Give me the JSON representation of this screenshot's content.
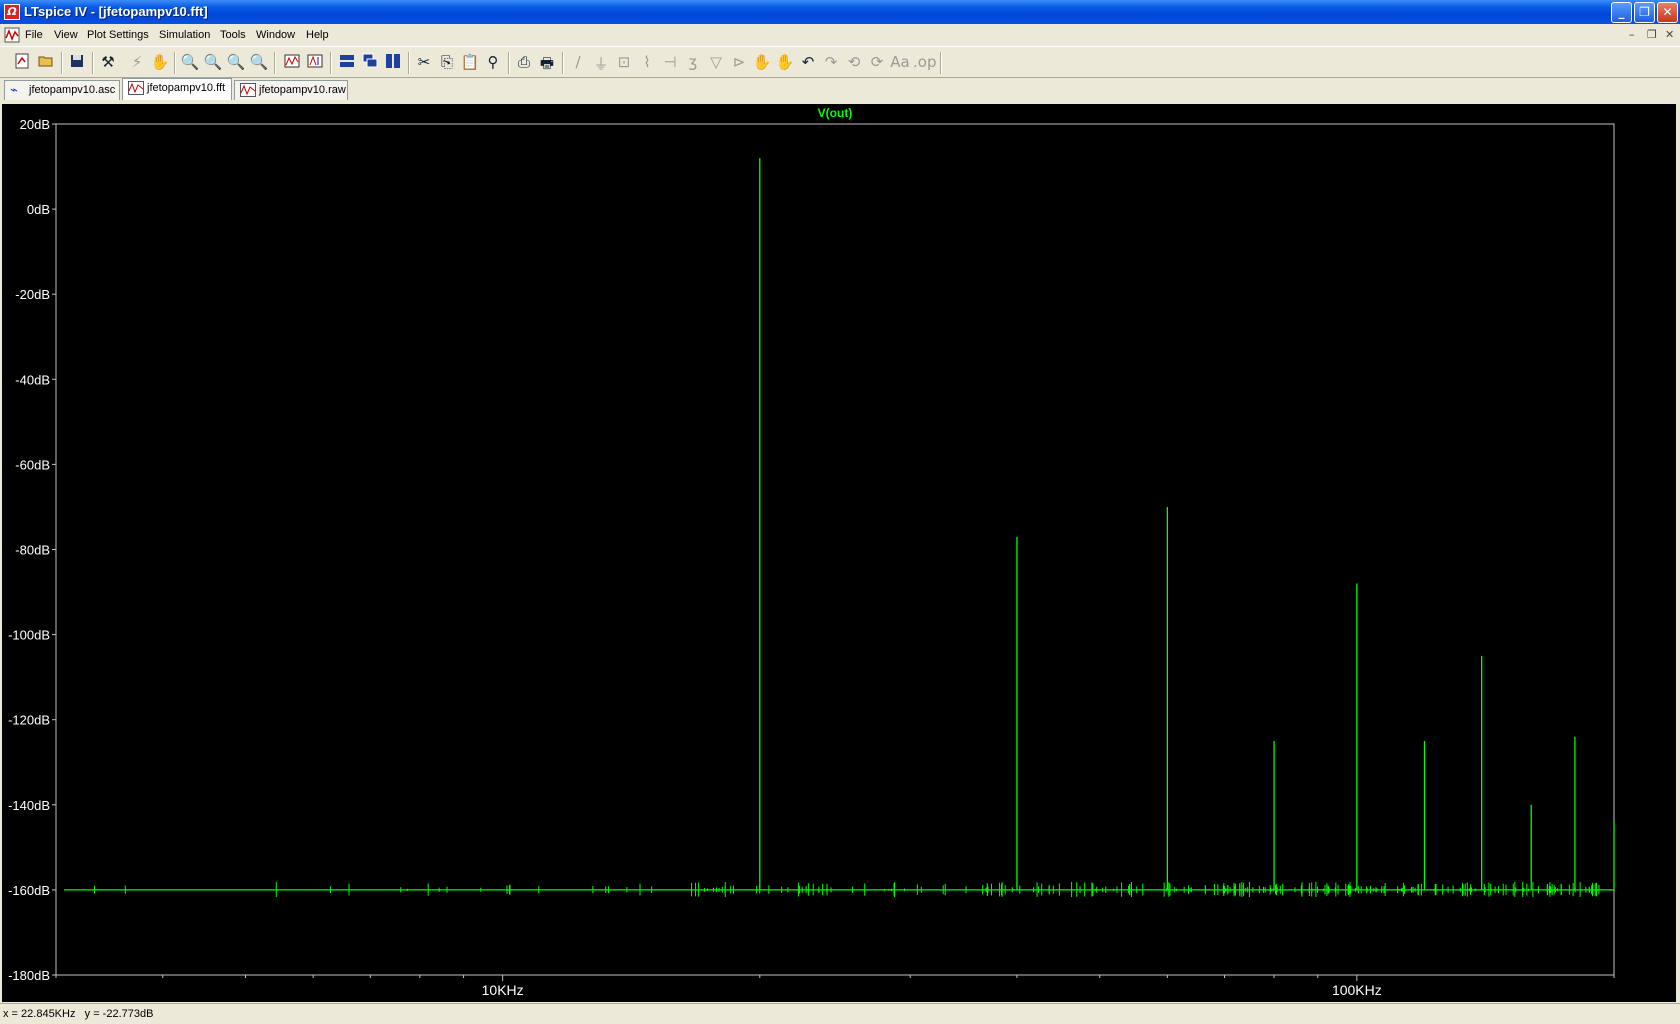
{
  "window": {
    "title": "LTspice IV - [jfetopampv10.fft]",
    "buttons": {
      "minimize": "_",
      "maximize": "❐",
      "close": "✕"
    }
  },
  "menu": {
    "items": [
      "File",
      "View",
      "Plot Settings",
      "Simulation",
      "Tools",
      "Window",
      "Help"
    ],
    "mdi": {
      "minimize": "–",
      "restore": "❐",
      "close": "✕"
    }
  },
  "tabs": [
    {
      "label": "jfetopampv10.asc",
      "icon": "schematic-icon",
      "active": false
    },
    {
      "label": "jfetopampv10.fft",
      "icon": "waveform-icon",
      "active": true
    },
    {
      "label": "jfetopampv10.raw",
      "icon": "waveform-icon",
      "active": false
    }
  ],
  "status": {
    "x_readout": "x = 22.845KHz",
    "y_readout": "y = -22.773dB"
  },
  "colors": {
    "trace": "#00ff00",
    "plot_bg": "#000000",
    "axis_text": "#ffffff"
  },
  "chart_data": {
    "type": "line",
    "title": "V(out)",
    "x_scale": "log",
    "x_unit": "Hz",
    "xlim": [
      3000,
      200000
    ],
    "ylim": [
      -180,
      20
    ],
    "x_ticks": [
      {
        "value": 10000,
        "label": "10KHz"
      },
      {
        "value": 100000,
        "label": "100KHz"
      }
    ],
    "y_ticks": [
      {
        "value": 20,
        "label": "20dB"
      },
      {
        "value": 0,
        "label": "0dB"
      },
      {
        "value": -20,
        "label": "-20dB"
      },
      {
        "value": -40,
        "label": "-40dB"
      },
      {
        "value": -60,
        "label": "-60dB"
      },
      {
        "value": -80,
        "label": "-80dB"
      },
      {
        "value": -100,
        "label": "-100dB"
      },
      {
        "value": -120,
        "label": "-120dB"
      },
      {
        "value": -140,
        "label": "-140dB"
      },
      {
        "value": -160,
        "label": "-160dB"
      },
      {
        "value": -180,
        "label": "-180dB"
      }
    ],
    "noise_floor": -160,
    "series": [
      {
        "name": "V(out)",
        "peaks": [
          {
            "f": 20000,
            "db": 12
          },
          {
            "f": 40000,
            "db": -77
          },
          {
            "f": 60000,
            "db": -70
          },
          {
            "f": 80000,
            "db": -125
          },
          {
            "f": 100000,
            "db": -88
          },
          {
            "f": 120000,
            "db": -125
          },
          {
            "f": 140000,
            "db": -105
          },
          {
            "f": 160000,
            "db": -140
          },
          {
            "f": 180000,
            "db": -124
          },
          {
            "f": 200000,
            "db": -144
          }
        ]
      }
    ]
  }
}
